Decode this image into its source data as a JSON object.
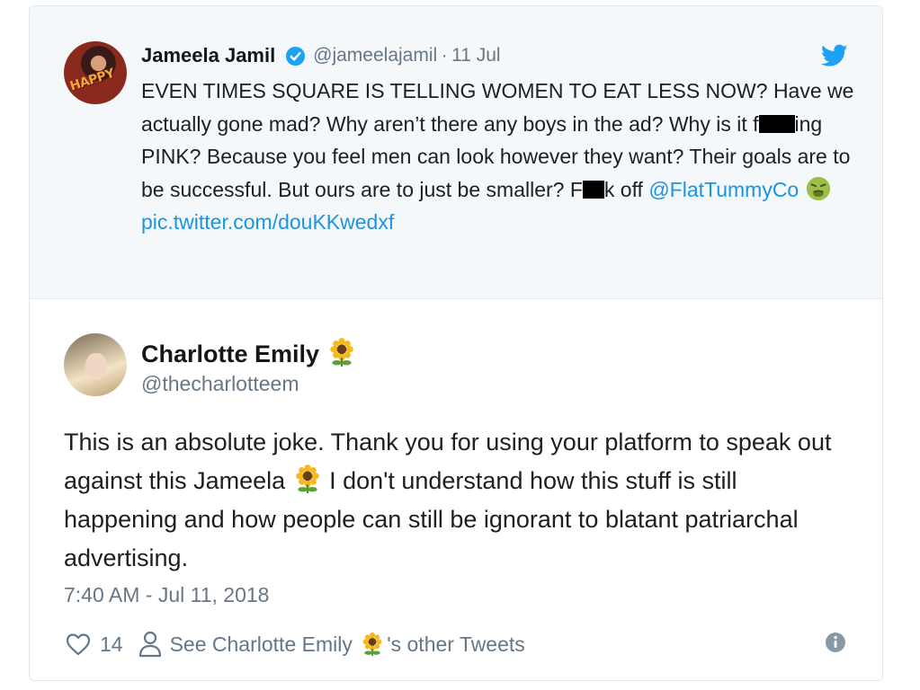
{
  "quoted_tweet": {
    "name": "Jameela Jamil",
    "handle": "@jameelajamil",
    "separator": "·",
    "date": "11 Jul",
    "avatar_text": "HAPPY",
    "text_parts": {
      "line1": "EVEN TIMES SQUARE IS TELLING WOMEN TO EAT LESS NOW? Have we actually gone mad? Why aren’t there any boys in the ad? Why is it f",
      "line1b": "ing PINK? Because you feel men can look however they want? Their goals are to be successful. But ours are to just be smaller? F",
      "line1c": "k off ",
      "mention": "@FlatTummyCo",
      "link": "pic.twitter.com/douKKwedxf"
    },
    "icons": {
      "verified": "verified-badge-icon",
      "brand": "twitter-bird-icon",
      "emoji": "nauseated-face-emoji"
    }
  },
  "reply": {
    "name": "Charlotte Emily",
    "handle": "@thecharlotteem",
    "text_a": "This is an absolute joke. Thank you for using your platform to speak out against this Jameela ",
    "text_b": " I don't understand how this stuff is still happening and how people can still be ignorant to blatant patriarchal advertising.",
    "timestamp": "7:40 AM - Jul 11, 2018",
    "name_emoji": "sunflower-emoji"
  },
  "actions": {
    "like_count": "14",
    "see_tweets_prefix": "See Charlotte Emily ",
    "see_tweets_suffix": "'s other Tweets",
    "icons": [
      "heart-icon",
      "person-icon",
      "info-icon"
    ]
  },
  "colors": {
    "link": "#1b95e0",
    "muted": "#657786",
    "quoted_bg": "#f5f8fa",
    "twitter_blue": "#1da1f2"
  }
}
